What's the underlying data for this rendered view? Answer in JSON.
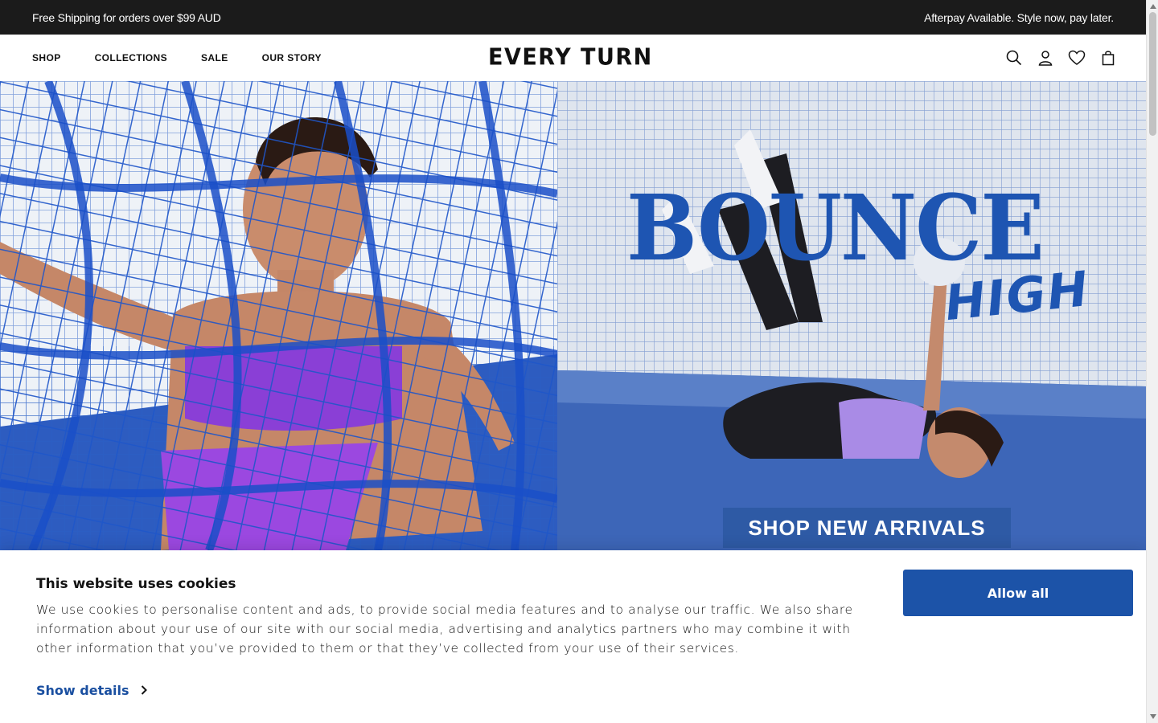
{
  "announcement": {
    "left": "Free Shipping for orders over $99 AUD",
    "right": "Afterpay Available. Style now, pay later."
  },
  "header": {
    "logo": "EVERY TURN",
    "nav": [
      "SHOP",
      "COLLECTIONS",
      "SALE",
      "OUR STORY"
    ],
    "icons": [
      "search-icon",
      "account-icon",
      "wishlist-heart-icon",
      "cart-bag-icon"
    ]
  },
  "hero": {
    "headline": "BOUNCE",
    "subheadline": "HIGH",
    "cta": "SHOP NEW ARRIVALS"
  },
  "cookie_banner": {
    "title": "This website uses cookies",
    "text": "We use cookies to personalise content and ads, to provide social media features and to analyse our traffic. We also share information about your use of our site with our social media, advertising and analytics partners who may combine it with other information that you’ve provided to them or that they’ve collected from your use of their services.",
    "show_details": "Show details",
    "allow_all": "Allow all"
  },
  "colors": {
    "announcement_bg": "#1b1b1b",
    "brand_blue": "#1c53a8",
    "link_blue": "#1a4fa0"
  }
}
